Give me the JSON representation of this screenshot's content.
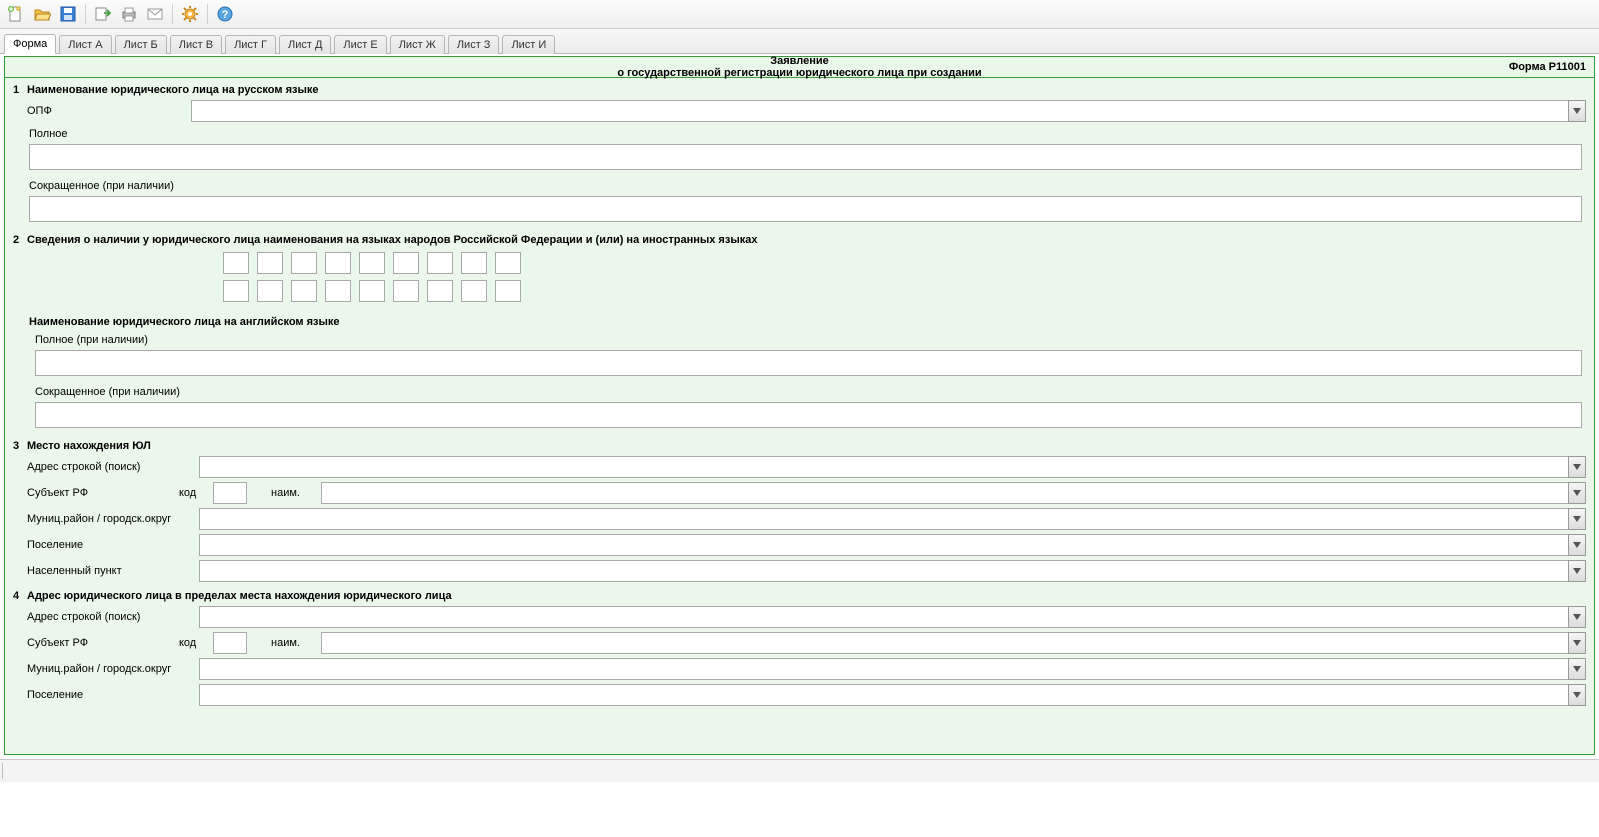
{
  "toolbar": {
    "new": "new-document",
    "open": "open-document",
    "save": "save-document",
    "export": "export",
    "print": "print",
    "mail": "mail",
    "settings": "settings",
    "help": "help"
  },
  "tabs": [
    {
      "label": "Форма",
      "active": true
    },
    {
      "label": "Лист А",
      "active": false
    },
    {
      "label": "Лист Б",
      "active": false
    },
    {
      "label": "Лист В",
      "active": false
    },
    {
      "label": "Лист Г",
      "active": false
    },
    {
      "label": "Лист Д",
      "active": false
    },
    {
      "label": "Лист Е",
      "active": false
    },
    {
      "label": "Лист Ж",
      "active": false
    },
    {
      "label": "Лист З",
      "active": false
    },
    {
      "label": "Лист И",
      "active": false
    }
  ],
  "header": {
    "title_line1": "Заявление",
    "title_line2": "о государственной регистрации юридического лица при создании",
    "form_number": "Форма Р11001"
  },
  "section1": {
    "num": "1",
    "title": "Наименование юридического лица на русском языке",
    "opf_label": "ОПФ",
    "opf_value": "",
    "full_label": "Полное",
    "full_value": "",
    "short_label": "Сокращенное (при наличии)",
    "short_value": ""
  },
  "section2": {
    "num": "2",
    "title": "Сведения о наличии у юридического лица наименования на языках народов Российской Федерации и (или) на иностранных языках",
    "eng_title": "Наименование юридического лица на английском языке",
    "full_label": "Полное (при наличии)",
    "full_value": "",
    "short_label": "Сокращенное (при наличии)",
    "short_value": ""
  },
  "section3": {
    "num": "3",
    "title": "Место нахождения ЮЛ",
    "addr_search_label": "Адрес строкой (поиск)",
    "addr_search_value": "",
    "subject_label": "Субъект РФ",
    "kod_label": "код",
    "kod_value": "",
    "naim_label": "наим.",
    "naim_value": "",
    "munic_label": "Муниц.район / городск.округ",
    "munic_value": "",
    "pos_label": "Поселение",
    "pos_value": "",
    "np_label": "Населенный пункт",
    "np_value": ""
  },
  "section4": {
    "num": "4",
    "title": "Адрес юридического лица в пределах места нахождения юридического лица",
    "addr_search_label": "Адрес строкой (поиск)",
    "addr_search_value": "",
    "subject_label": "Субъект РФ",
    "kod_label": "код",
    "kod_value": "",
    "naim_label": "наим.",
    "naim_value": "",
    "munic_label": "Муниц.район / городск.округ",
    "munic_value": "",
    "pos_label": "Поселение",
    "pos_value": ""
  }
}
